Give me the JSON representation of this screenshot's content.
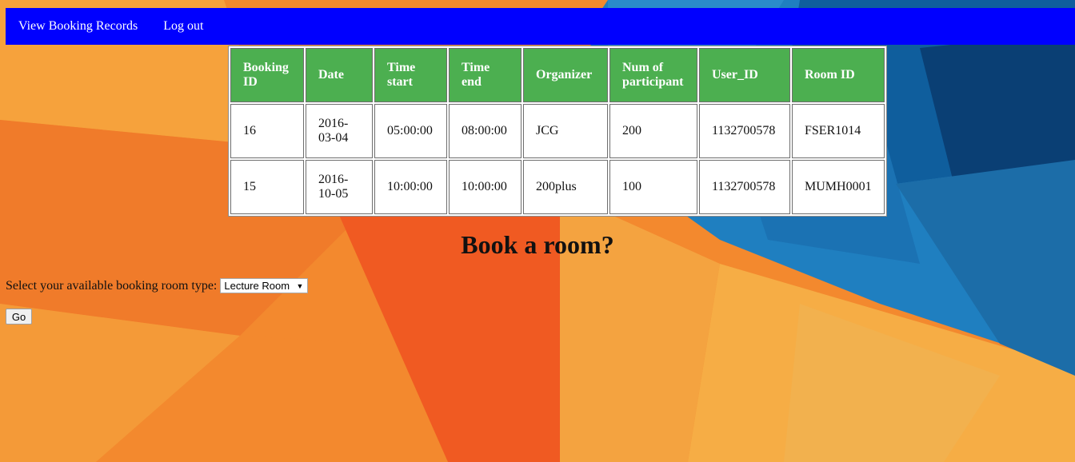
{
  "nav": {
    "view_records": "View Booking Records",
    "logout": "Log out"
  },
  "table": {
    "headers": [
      "Booking ID",
      "Date",
      "Time start",
      "Time end",
      "Organizer",
      "Num of participant",
      "User_ID",
      "Room ID"
    ],
    "rows": [
      [
        "16",
        "2016-03-04",
        "05:00:00",
        "08:00:00",
        "JCG",
        "200",
        "1132700578",
        "FSER1014"
      ],
      [
        "15",
        "2016-10-05",
        "10:00:00",
        "10:00:00",
        "200plus",
        "100",
        "1132700578",
        "MUMH0001"
      ]
    ]
  },
  "booking": {
    "title": "Book a room?",
    "select_label": "Select your available booking room type:",
    "selected_room_type": "Lecture Room",
    "go_label": "Go"
  },
  "colors": {
    "navbar": "#0000ff",
    "table_header": "#4caf50",
    "background_orange": "#f3892e",
    "background_blue": "#1f7fc0"
  }
}
